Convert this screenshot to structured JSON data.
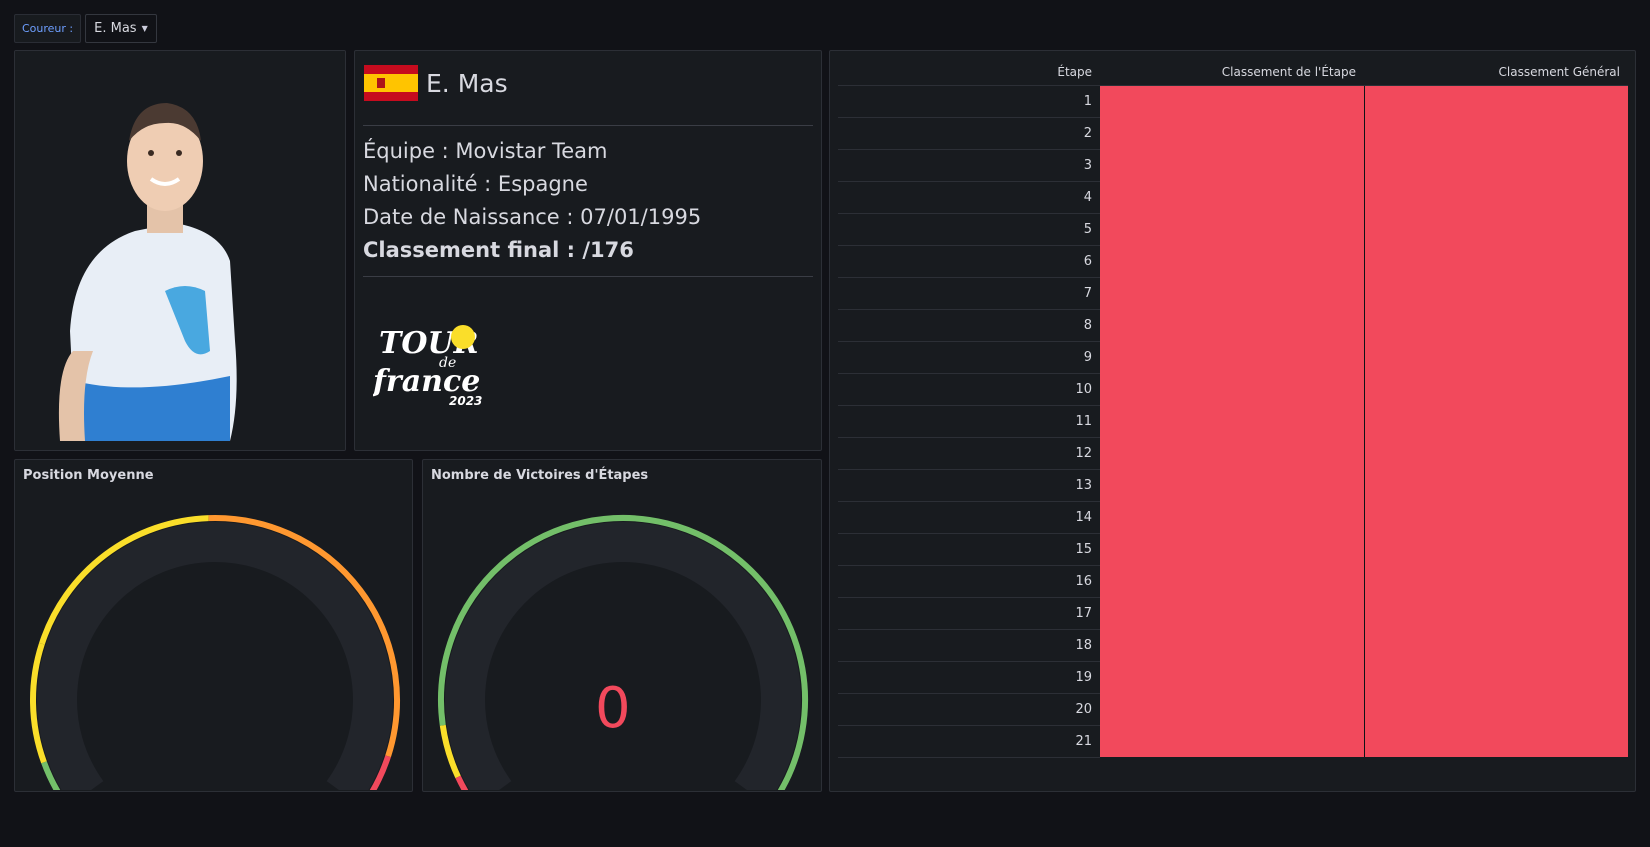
{
  "variable": {
    "label": "Coureur :",
    "value": "E. Mas"
  },
  "rider": {
    "name": "E. Mas",
    "team_line": "Équipe : Movistar Team",
    "nationality_line": "Nationalité : Espagne",
    "birth_line": "Date de Naissance : 07/01/1995",
    "final_rank_line": "Classement final : /176"
  },
  "logo": {
    "line1": "TOUR",
    "line2": "de",
    "line3": "france",
    "year": "2023"
  },
  "gauges": {
    "avg_position": {
      "title": "Position Moyenne"
    },
    "stage_wins": {
      "title": "Nombre de Victoires d'Étapes",
      "value": "0"
    }
  },
  "table": {
    "headers": [
      "Étape",
      "Classement de l'Étape",
      "Classement Général"
    ],
    "stages": [
      "1",
      "2",
      "3",
      "4",
      "5",
      "6",
      "7",
      "8",
      "9",
      "10",
      "11",
      "12",
      "13",
      "14",
      "15",
      "16",
      "17",
      "18",
      "19",
      "20",
      "21"
    ]
  },
  "colors": {
    "red": "#f2495c",
    "orange": "#ff9830",
    "yellow": "#fade2a",
    "green": "#73bf69",
    "flag_red": "#c60b1e",
    "flag_yellow": "#ffc400"
  }
}
